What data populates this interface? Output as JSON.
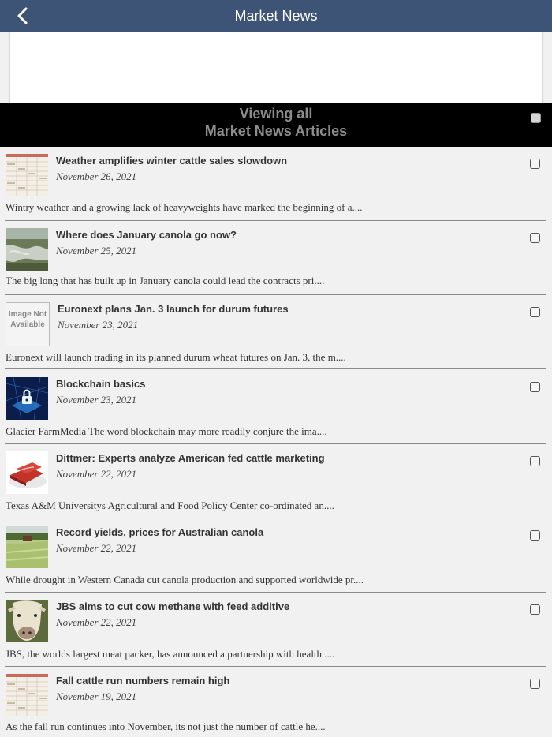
{
  "header": {
    "title": "Market News",
    "back_icon": "chevron-left-icon"
  },
  "banner": {
    "line1": "Viewing all",
    "line2": "Market News Articles"
  },
  "colors": {
    "header_bg": "#3d5476",
    "banner_bg": "#000000",
    "banner_text": "#8c8c8c",
    "page_bg": "#f1f1f1"
  },
  "articles": [
    {
      "title": "Weather amplifies winter cattle sales slowdown",
      "date": "November 26, 2021",
      "excerpt": "Wintry weather and a growing lack of heavyweights have marked the beginning of a....",
      "thumb": "price-table-image"
    },
    {
      "title": "Where does January canola go now?",
      "date": "November 25, 2021",
      "excerpt": "The big long that has built up in January canola could lead the contracts pri....",
      "thumb": "flooded-field-image"
    },
    {
      "title": "Euronext plans Jan. 3 launch for durum futures",
      "date": "November 23, 2021",
      "excerpt": "Euronext will launch trading in its planned durum wheat futures on Jan. 3, the m....",
      "thumb": "image-not-available",
      "placeholder_text": "Image Not Available"
    },
    {
      "title": "Blockchain basics",
      "date": "November 23, 2021",
      "excerpt": "Glacier FarmMedia The word blockchain may more readily conjure the ima....",
      "thumb": "blockchain-lock-image"
    },
    {
      "title": "Dittmer: Experts analyze American fed cattle marketing",
      "date": "November 22, 2021",
      "excerpt": "Texas A&M Universitys Agricultural and Food Policy Center co-ordinated an....",
      "thumb": "raw-beef-image"
    },
    {
      "title": "Record yields, prices for Australian canola",
      "date": "November 22, 2021",
      "excerpt": "While drought in Western Canada cut canola production and supported worldwide pr....",
      "thumb": "farm-field-image"
    },
    {
      "title": "JBS aims to cut cow methane with feed additive",
      "date": "November 22, 2021",
      "excerpt": "JBS, the worlds largest meat packer, has announced a partnership with health ....",
      "thumb": "cow-face-image"
    },
    {
      "title": "Fall cattle run numbers remain high",
      "date": "November 19, 2021",
      "excerpt": "As the fall run continues into November, its not just the number of cattle he....",
      "thumb": "price-table-image"
    }
  ]
}
